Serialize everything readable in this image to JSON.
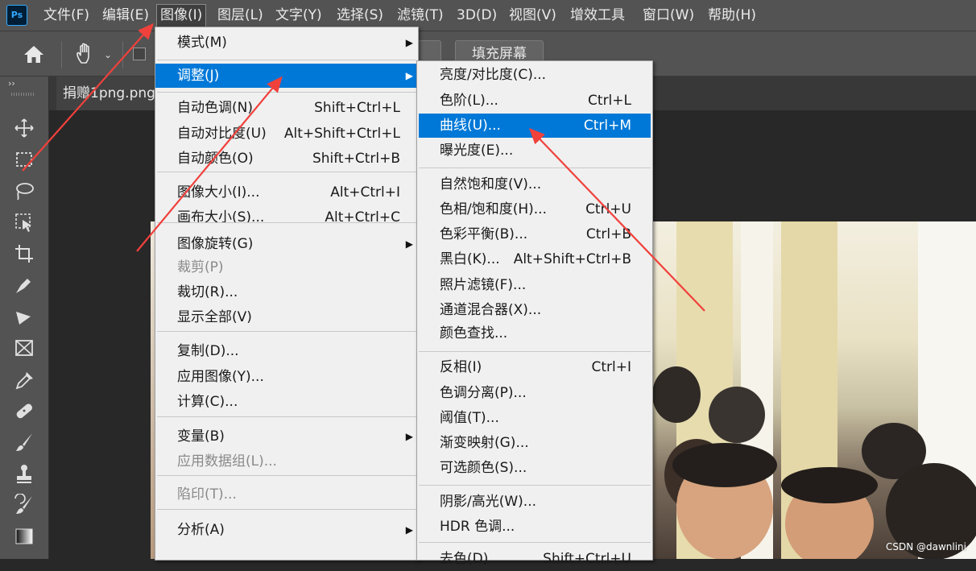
{
  "app": {
    "logo": "Ps"
  },
  "menubar": {
    "items": [
      "文件(F)",
      "编辑(E)",
      "图像(I)",
      "图层(L)",
      "文字(Y)",
      "选择(S)",
      "滤镜(T)",
      "3D(D)",
      "视图(V)",
      "增效工具",
      "窗口(W)",
      "帮助(H)"
    ],
    "active": "图像(I)"
  },
  "options_bar": {
    "buttons": [
      "",
      "填充屏幕"
    ]
  },
  "document_tab": {
    "title": "捐赠1png.png"
  },
  "toolbar": {
    "collapse_glyph": "››",
    "tools": [
      "move-icon",
      "marquee-icon",
      "lasso-icon",
      "object-select-icon",
      "crop-icon",
      "pen-icon",
      "slice-icon",
      "frame-icon",
      "eyedropper-icon",
      "healing-brush-icon",
      "brush-icon",
      "stamp-icon",
      "history-brush-icon",
      "gradient-icon"
    ]
  },
  "image_menu": {
    "items": [
      {
        "label": "模式(M)",
        "shortcut": "",
        "submenu": true,
        "disabled": false,
        "highlight": false
      },
      {
        "label": "调整(J)",
        "shortcut": "",
        "submenu": true,
        "disabled": false,
        "highlight": true
      },
      {
        "label": "自动色调(N)",
        "shortcut": "Shift+Ctrl+L",
        "submenu": false,
        "disabled": false,
        "highlight": false
      },
      {
        "label": "自动对比度(U)",
        "shortcut": "Alt+Shift+Ctrl+L",
        "submenu": false,
        "disabled": false,
        "highlight": false
      },
      {
        "label": "自动颜色(O)",
        "shortcut": "Shift+Ctrl+B",
        "submenu": false,
        "disabled": false,
        "highlight": false
      },
      {
        "label": "图像大小(I)...",
        "shortcut": "Alt+Ctrl+I",
        "submenu": false,
        "disabled": false,
        "highlight": false
      },
      {
        "label": "画布大小(S)...",
        "shortcut": "Alt+Ctrl+C",
        "submenu": false,
        "disabled": false,
        "highlight": false
      },
      {
        "label": "图像旋转(G)",
        "shortcut": "",
        "submenu": true,
        "disabled": false,
        "highlight": false
      },
      {
        "label": "裁剪(P)",
        "shortcut": "",
        "submenu": false,
        "disabled": true,
        "highlight": false
      },
      {
        "label": "裁切(R)...",
        "shortcut": "",
        "submenu": false,
        "disabled": false,
        "highlight": false
      },
      {
        "label": "显示全部(V)",
        "shortcut": "",
        "submenu": false,
        "disabled": false,
        "highlight": false
      },
      {
        "label": "复制(D)...",
        "shortcut": "",
        "submenu": false,
        "disabled": false,
        "highlight": false
      },
      {
        "label": "应用图像(Y)...",
        "shortcut": "",
        "submenu": false,
        "disabled": false,
        "highlight": false
      },
      {
        "label": "计算(C)...",
        "shortcut": "",
        "submenu": false,
        "disabled": false,
        "highlight": false
      },
      {
        "label": "变量(B)",
        "shortcut": "",
        "submenu": true,
        "disabled": false,
        "highlight": false
      },
      {
        "label": "应用数据组(L)...",
        "shortcut": "",
        "submenu": false,
        "disabled": true,
        "highlight": false
      },
      {
        "label": "陷印(T)...",
        "shortcut": "",
        "submenu": false,
        "disabled": true,
        "highlight": false
      },
      {
        "label": "分析(A)",
        "shortcut": "",
        "submenu": true,
        "disabled": false,
        "highlight": false
      }
    ]
  },
  "adjust_submenu": {
    "items": [
      {
        "label": "亮度/对比度(C)...",
        "shortcut": "",
        "highlight": false
      },
      {
        "label": "色阶(L)...",
        "shortcut": "Ctrl+L",
        "highlight": false
      },
      {
        "label": "曲线(U)...",
        "shortcut": "Ctrl+M",
        "highlight": true
      },
      {
        "label": "曝光度(E)...",
        "shortcut": "",
        "highlight": false
      },
      {
        "label": "自然饱和度(V)...",
        "shortcut": "",
        "highlight": false
      },
      {
        "label": "色相/饱和度(H)...",
        "shortcut": "Ctrl+U",
        "highlight": false
      },
      {
        "label": "色彩平衡(B)...",
        "shortcut": "Ctrl+B",
        "highlight": false
      },
      {
        "label": "黑白(K)...",
        "shortcut": "Alt+Shift+Ctrl+B",
        "highlight": false
      },
      {
        "label": "照片滤镜(F)...",
        "shortcut": "",
        "highlight": false
      },
      {
        "label": "通道混合器(X)...",
        "shortcut": "",
        "highlight": false
      },
      {
        "label": "颜色查找...",
        "shortcut": "",
        "highlight": false
      },
      {
        "label": "反相(I)",
        "shortcut": "Ctrl+I",
        "highlight": false
      },
      {
        "label": "色调分离(P)...",
        "shortcut": "",
        "highlight": false
      },
      {
        "label": "阈值(T)...",
        "shortcut": "",
        "highlight": false
      },
      {
        "label": "渐变映射(G)...",
        "shortcut": "",
        "highlight": false
      },
      {
        "label": "可选颜色(S)...",
        "shortcut": "",
        "highlight": false
      },
      {
        "label": "阴影/高光(W)...",
        "shortcut": "",
        "highlight": false
      },
      {
        "label": "HDR 色调...",
        "shortcut": "",
        "highlight": false
      },
      {
        "label": "去色(D)",
        "shortcut": "Shift+Ctrl+U",
        "highlight": false
      }
    ]
  },
  "watermark": "CSDN @dawnlini",
  "colors": {
    "highlight": "#0078d7",
    "menu_bg": "#f0f0f0",
    "annotation_arrow": "#f0413c"
  }
}
